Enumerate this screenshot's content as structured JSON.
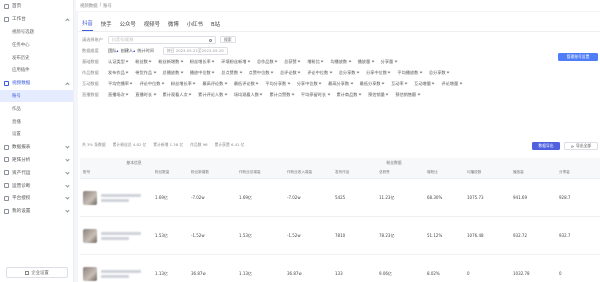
{
  "breadcrumb": [
    "视频数据",
    "账号"
  ],
  "sidebar": {
    "items": [
      {
        "label": "首页",
        "icon": "home-icon",
        "chev": false
      },
      {
        "label": "工作台",
        "icon": "desk-icon",
        "chev": "up"
      },
      {
        "label": "视频号选题",
        "sub": true
      },
      {
        "label": "任务中心",
        "sub": true
      },
      {
        "label": "发布历史",
        "sub": true
      },
      {
        "label": "应用插件",
        "sub": true
      },
      {
        "label": "视频数据",
        "icon": "chart-icon",
        "chev": "up",
        "active": true
      },
      {
        "label": "账号",
        "sub": true,
        "active": true
      },
      {
        "label": "作品",
        "sub": true
      },
      {
        "label": "直播",
        "sub": true
      },
      {
        "label": "设置",
        "sub": true
      },
      {
        "label": "数据报表",
        "icon": "report-icon",
        "chev": "down"
      },
      {
        "label": "矩阵分析",
        "icon": "matrix-icon",
        "chev": "down"
      },
      {
        "label": "资产代运",
        "icon": "asset-icon",
        "chev": "down"
      },
      {
        "label": "运营诊断",
        "icon": "diagnose-icon",
        "chev": "down"
      },
      {
        "label": "平台授权",
        "icon": "auth-icon",
        "chev": "down"
      },
      {
        "label": "我的设置",
        "icon": "settings-icon",
        "chev": "down"
      }
    ],
    "footer": "企业设置"
  },
  "tabs": [
    "抖音",
    "快手",
    "公众号",
    "视频号",
    "微博",
    "小红书",
    "B站"
  ],
  "active_tab": 0,
  "filters": {
    "search_label": "请选择账户",
    "search_placeholder": "抖音号/昵称",
    "search_btn": "搜索",
    "group_label": "数据维度",
    "group_options": [
      "团队",
      "创建人",
      "统计时间"
    ],
    "date_hint": "按日  2023-05-22至2023-05-29",
    "metric_rows": [
      {
        "label": "基础数据",
        "items": [
          "认证类型",
          "粉丝数",
          "粉丝新增数",
          "粉丝增长率",
          "环境粉丝新增",
          "总作品数",
          "总获赞",
          "增粉比",
          "均播放数",
          "播放量",
          "分享量"
        ]
      },
      {
        "label": "作品数据",
        "items": [
          "发布作品",
          "带货作品",
          "总播放数",
          "播放中位数",
          "总点赞数",
          "点赞中位数",
          "总评论数",
          "评论中位数",
          "总分享数",
          "分享中位数",
          "平均播放数",
          "总分享数"
        ]
      },
      {
        "label": "互动数据",
        "items": [
          "平均完播率",
          "评论中位数",
          "粉丝增长率",
          "最高评论数",
          "最低评论数",
          "平均分享数",
          "分享中位数",
          "最高分享数",
          "最低分享数",
          "互动率",
          "互动增量",
          "评论增量"
        ]
      },
      {
        "label": "直播数据",
        "items": [
          "直播场次",
          "直播时长",
          "累计观看人次",
          "累计评论人数",
          "场均观看人数",
          "累计点赞数",
          "平均停留时长",
          "累计商品数",
          "预估销量",
          "预估销售额"
        ]
      }
    ],
    "export_account": "管理账号设置"
  },
  "summary": {
    "count": "共 3% 条数据",
    "fans_total": "累计粉丝总 4.82 亿",
    "new_fans": "累计新增 1.38 亿",
    "works": "作品数 96",
    "likes": "累计获赞 6.41 亿"
  },
  "buttons": {
    "export": "数据导出",
    "import": "导出全部"
  },
  "table": {
    "group_headers": [
      "基本信息",
      "粉丝数据"
    ],
    "columns": [
      "账号",
      "粉丝数量",
      "粉丝新增数",
      "作粉丝总增量",
      "作粉丝收入增量",
      "发布作品",
      "总获赞",
      "增粉比",
      "均播放数",
      "播放量",
      "分享量"
    ],
    "rows": [
      {
        "values": [
          "1.69亿",
          "-7.02w",
          "1.69亿",
          "-7.02w",
          "5425",
          "11.23亿",
          "68.30%",
          "1075.73",
          "941.69",
          "928.7"
        ]
      },
      {
        "values": [
          "1.53亿",
          "-1.52w",
          "1.53亿",
          "-1.52w",
          "7810",
          "78.23亿",
          "51.12%",
          "1076.48",
          "932.72",
          "932.7"
        ]
      },
      {
        "values": [
          "1.13亿",
          "36.87w",
          "1.13亿",
          "36.87w",
          "133",
          "9.06亿",
          "8.02%",
          "0",
          "1032.78",
          "0"
        ]
      }
    ]
  }
}
